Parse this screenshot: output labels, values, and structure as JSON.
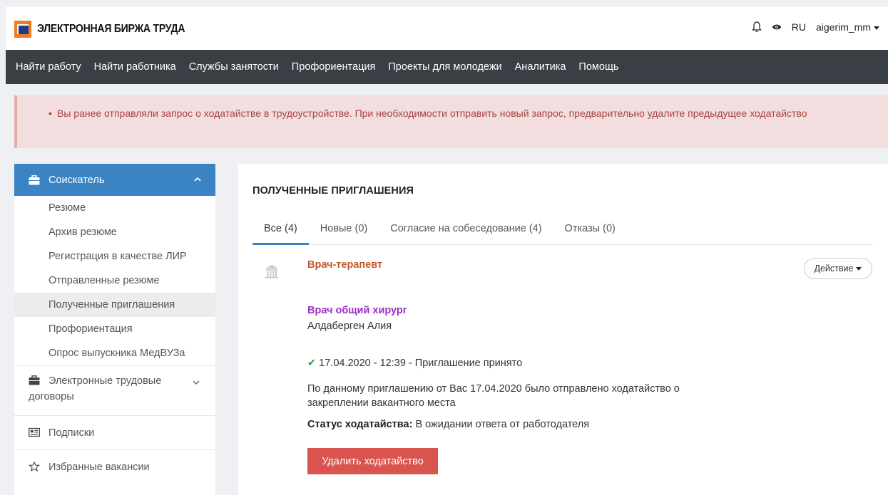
{
  "header": {
    "logo_text": "ЭЛЕКТРОННАЯ БИРЖА ТРУДА",
    "language": "RU",
    "username": "aigerim_mm",
    "icons": [
      "bell-icon",
      "eye-icon"
    ]
  },
  "nav": {
    "items": [
      "Найти работу",
      "Найти работника",
      "Службы занятости",
      "Профориентация",
      "Проекты для молодежи",
      "Аналитика",
      "Помощь"
    ]
  },
  "alert": {
    "bullet": "•",
    "text": "Вы ранее отправляли запрос о ходатайстве в трудоустройстве. При необходимости отправить новый запрос, предварительно удалите предыдущее ходатайство"
  },
  "sidebar": {
    "section_title": "Соискатель",
    "sub_items": [
      "Резюме",
      "Архив резюме",
      "Регистрация в качестве ЛИР",
      "Отправленные резюме",
      "Полученные приглашения",
      "Профориентация",
      "Опрос выпускника МедВУЗа"
    ],
    "active_index": 4,
    "groups": [
      "Электронные трудовые договоры",
      "Подписки",
      "Избранные вакансии"
    ]
  },
  "main": {
    "title": "ПОЛУЧЕННЫЕ ПРИГЛАШЕНИЯ",
    "tabs": [
      "Все (4)",
      "Новые (0)",
      "Согласие на собеседование (4)",
      "Отказы (0)"
    ],
    "active_tab": 0
  },
  "invitation": {
    "employer_position": "Врач-терапевт",
    "action_label": "Действие",
    "vacancy_title": "Врач общий хирург",
    "person_name": "Алдаберген Алия",
    "status_line": "17.04.2020 - 12:39 - Приглашение принято",
    "note": "По данному приглашению от Вас 17.04.2020 было отправлено ходатайство о закреплении вакантного места",
    "request_status_label": "Статус ходатайства:",
    "request_status_value": "В ожидании ответа от работодателя",
    "delete_label": "Удалить ходатайство"
  },
  "colors": {
    "nav_bg": "#3a3f45",
    "sidebar_active": "#3a84c4",
    "alert_bg": "#f2dede",
    "alert_text": "#a94442",
    "job_title": "#c0582b",
    "vacancy_title": "#9b2fc4",
    "delete_button": "#d9534f"
  }
}
